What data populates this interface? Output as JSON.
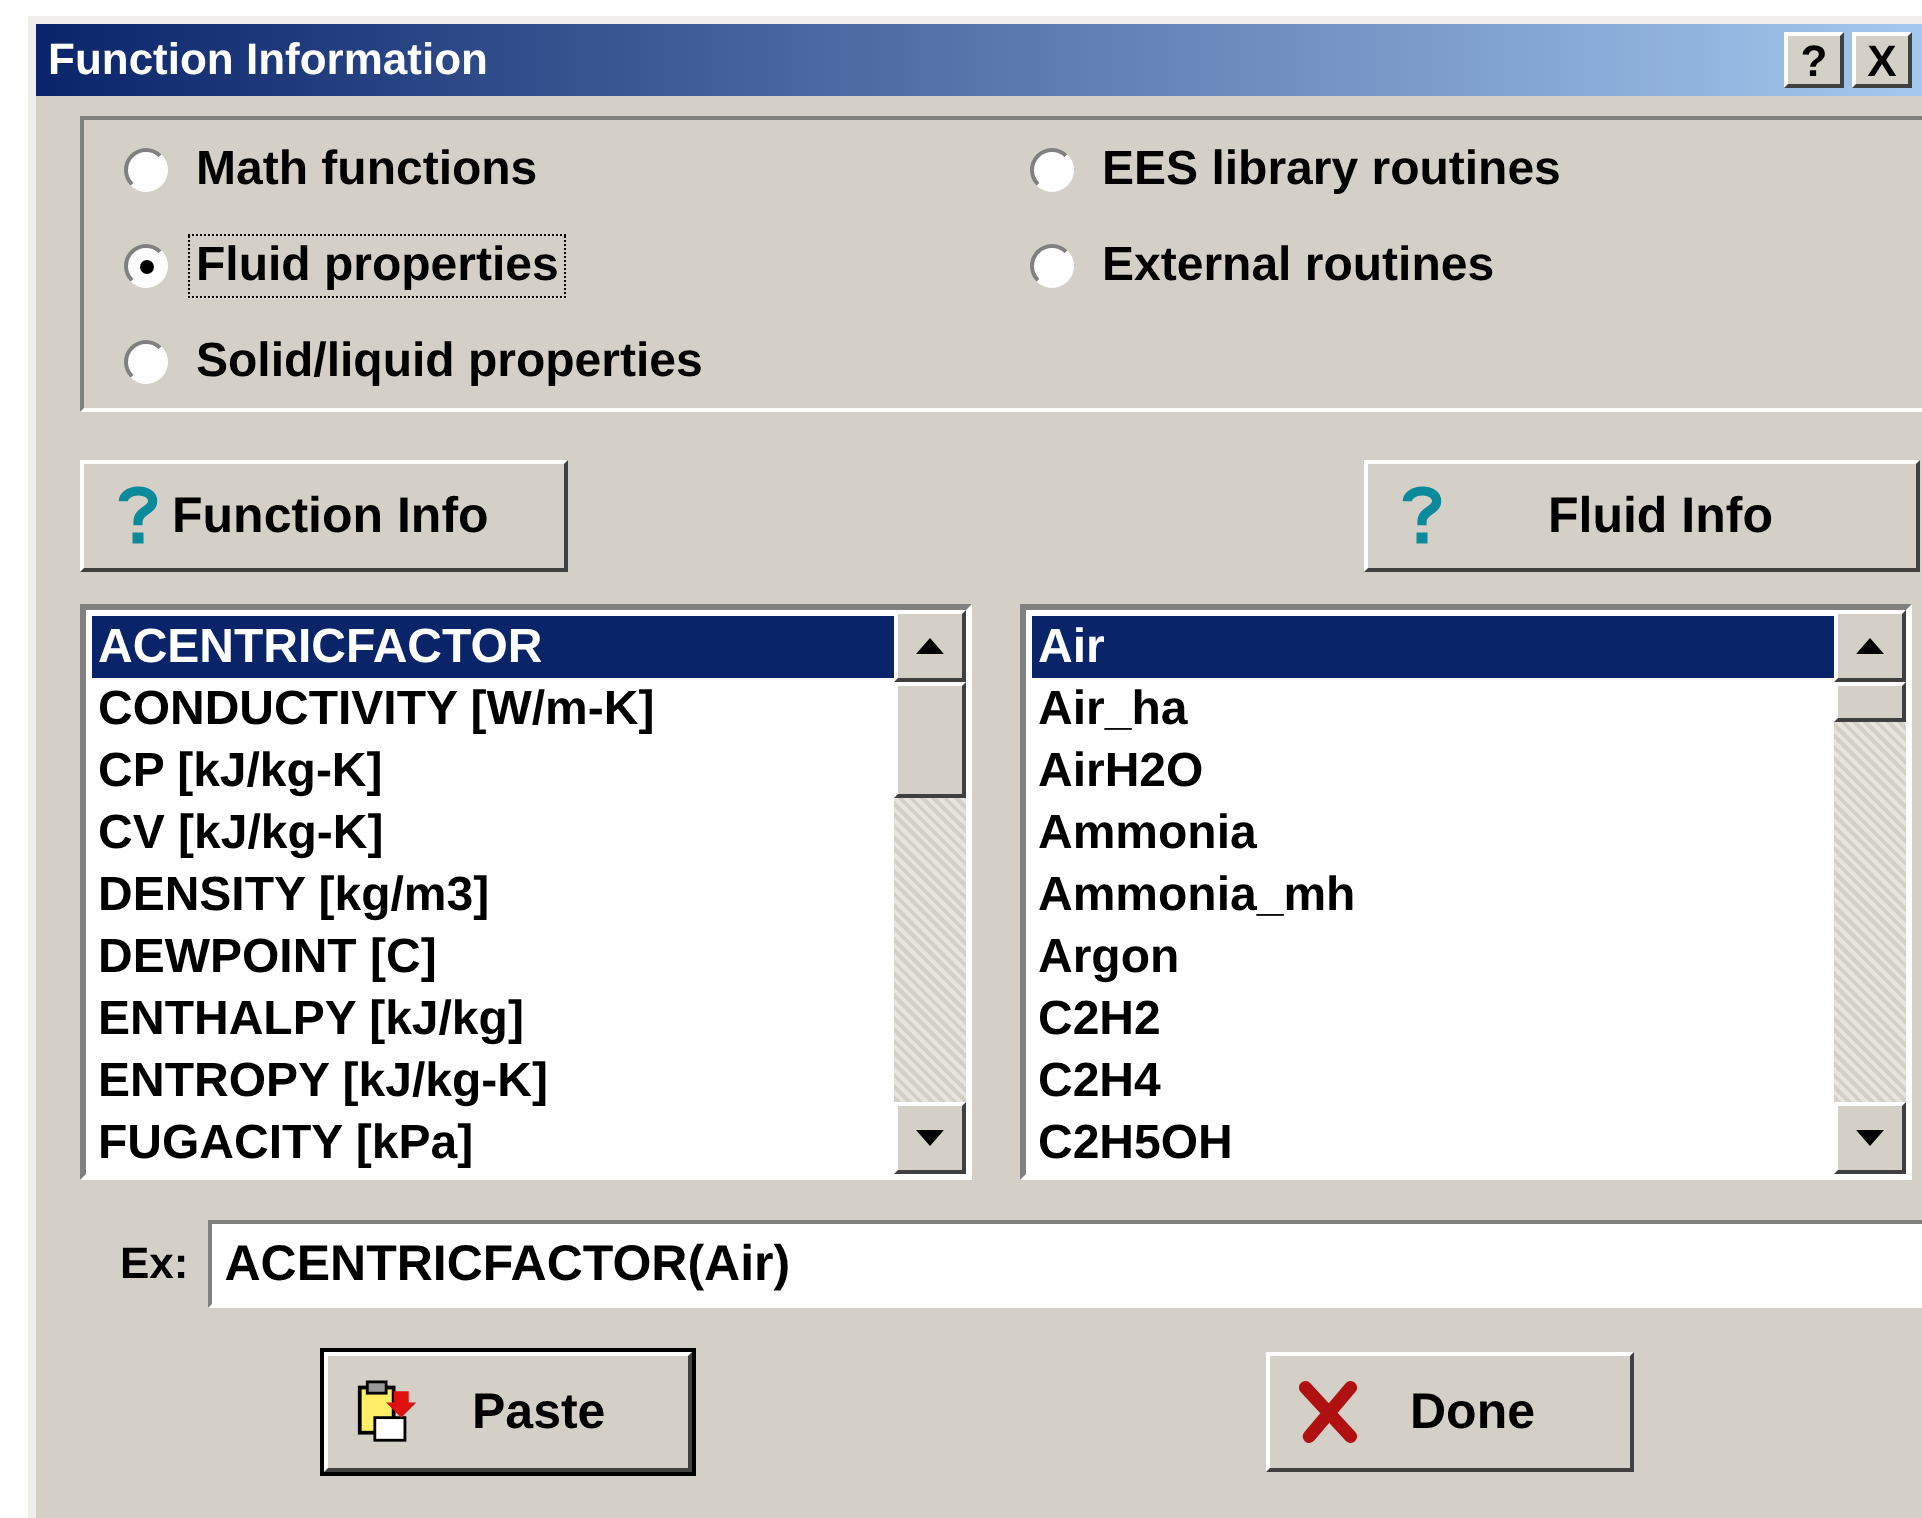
{
  "window": {
    "title": "Function Information",
    "title_buttons": [
      {
        "label": "?"
      },
      {
        "label": "X"
      }
    ]
  },
  "categories": {
    "columns": [
      {
        "options": [
          {
            "label": "Math functions",
            "selected": false,
            "focused": false
          },
          {
            "label": "Fluid properties",
            "selected": true,
            "focused": true
          },
          {
            "label": "Solid/liquid properties",
            "selected": false,
            "focused": false
          }
        ]
      },
      {
        "options": [
          {
            "label": "EES library routines",
            "selected": false,
            "focused": false
          },
          {
            "label": "External routines",
            "selected": false,
            "focused": false
          }
        ]
      }
    ]
  },
  "info_buttons": [
    {
      "label": "Function Info",
      "kind": "help"
    },
    {
      "label": "Fluid Info",
      "kind": "help"
    }
  ],
  "function_list": {
    "items": [
      {
        "label": "ACENTRICFACTOR",
        "selected": true
      },
      {
        "label": "CONDUCTIVITY [W/m-K]",
        "selected": false
      },
      {
        "label": "CP [kJ/kg-K]",
        "selected": false
      },
      {
        "label": "CV [kJ/kg-K]",
        "selected": false
      },
      {
        "label": "DENSITY [kg/m3]",
        "selected": false
      },
      {
        "label": "DEWPOINT [C]",
        "selected": false
      },
      {
        "label": "ENTHALPY [kJ/kg]",
        "selected": false
      },
      {
        "label": "ENTROPY [kJ/kg-K]",
        "selected": false
      },
      {
        "label": "FUGACITY [kPa]",
        "selected": false
      }
    ]
  },
  "fluid_list": {
    "items": [
      {
        "label": "Air",
        "selected": true
      },
      {
        "label": "Air_ha",
        "selected": false
      },
      {
        "label": "AirH2O",
        "selected": false
      },
      {
        "label": "Ammonia",
        "selected": false
      },
      {
        "label": "Ammonia_mh",
        "selected": false
      },
      {
        "label": "Argon",
        "selected": false
      },
      {
        "label": "C2H2",
        "selected": false
      },
      {
        "label": "C2H4",
        "selected": false
      },
      {
        "label": "C2H5OH",
        "selected": false
      }
    ]
  },
  "example": {
    "label": "Ex:",
    "value": "ACENTRICFACTOR(Air)"
  },
  "action_buttons": [
    {
      "label": "Paste",
      "kind": "paste"
    },
    {
      "label": "Done",
      "kind": "done"
    }
  ]
}
